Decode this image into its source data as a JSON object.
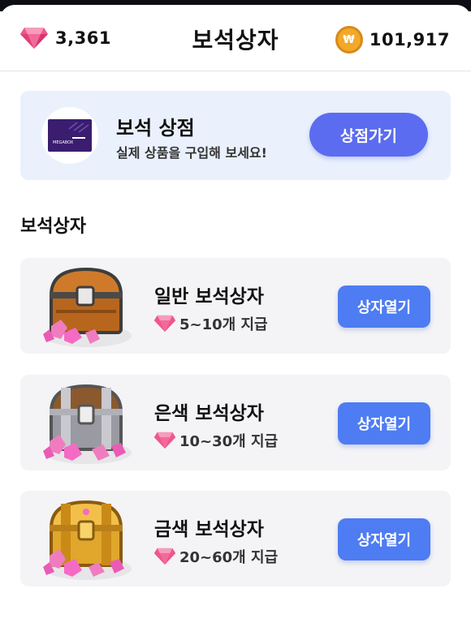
{
  "header": {
    "gem_balance": "3,361",
    "title": "보석상자",
    "coin_balance": "101,917",
    "coin_symbol": "₩"
  },
  "store_banner": {
    "thumb_text": "MEGABOX",
    "title": "보석 상점",
    "subtitle": "실제 상품을 구입해 보세요!",
    "button_label": "상점가기"
  },
  "section_title": "보석상자",
  "boxes": [
    {
      "name": "일반 보석상자",
      "reward": "5~10개 지급",
      "button_label": "상자열기",
      "tier": "normal"
    },
    {
      "name": "은색 보석상자",
      "reward": "10~30개 지급",
      "button_label": "상자열기",
      "tier": "silver"
    },
    {
      "name": "금색 보석상자",
      "reward": "20~60개 지급",
      "button_label": "상자열기",
      "tier": "gold"
    }
  ],
  "colors": {
    "gem": "#f0568a",
    "coin": "#f2a92a",
    "store_button": "#5b6cf0",
    "open_button": "#4e7cf2",
    "banner_bg": "#eaf1fd",
    "card_bg": "#f4f4f6"
  },
  "icons": {
    "gem": "pink-gem-icon",
    "coin": "won-coin-icon",
    "chest": "treasure-chest-icon"
  }
}
